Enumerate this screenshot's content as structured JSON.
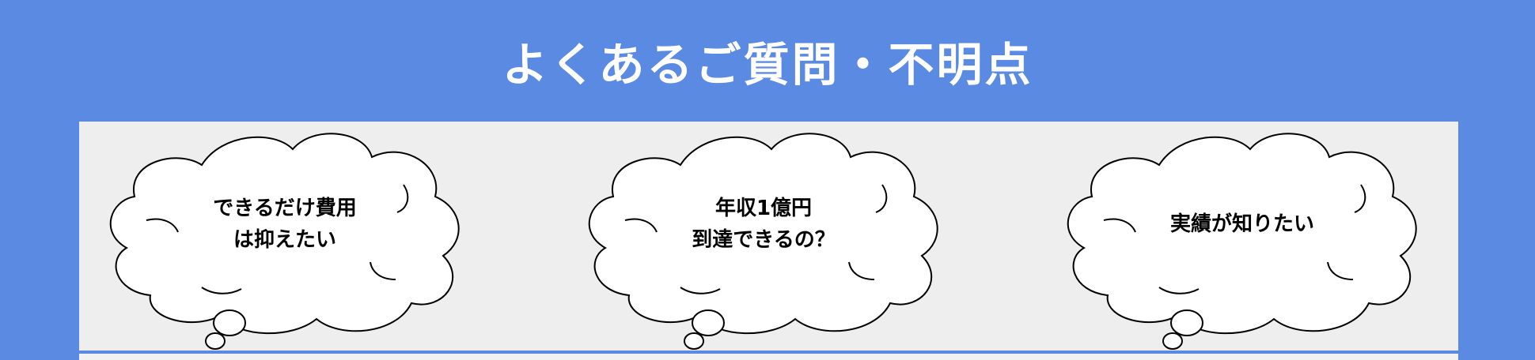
{
  "header": {
    "title": "よくあるご質問・不明点"
  },
  "questions": [
    {
      "line1": "できるだけ費用",
      "line2": "は抑えたい"
    },
    {
      "line1": "年収1億円",
      "line2": "到達できるの？"
    },
    {
      "line1": "実績が知りたい",
      "line2": ""
    }
  ],
  "colors": {
    "background": "#5b8ae2",
    "panel": "#eeeeee",
    "cloud_fill": "#ffffff",
    "cloud_stroke": "#000000"
  }
}
